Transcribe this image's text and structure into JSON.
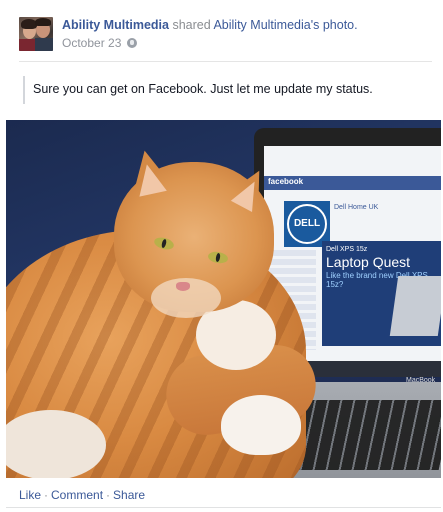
{
  "post": {
    "author": "Ability Multimedia",
    "verb": "shared",
    "shared_from": "Ability Multimedia",
    "shared_suffix": "'s photo.",
    "date": "October 23",
    "privacy_icon": "globe-icon",
    "quote": "Sure you can get on Facebook. Just let me update my status."
  },
  "photo": {
    "screen_brand": "facebook",
    "page_title": "Dell Home UK",
    "logo_text": "DELL",
    "banner_line1": "Dell XPS 15z",
    "banner_line2": "Laptop Quest",
    "banner_line3": "Like the brand new Dell XPS 15z?",
    "laptop_brand": "MacBook"
  },
  "actions": {
    "like": "Like",
    "comment": "Comment",
    "share": "Share",
    "separator": "·"
  },
  "colors": {
    "link": "#3b5998",
    "meta": "#90949c"
  }
}
